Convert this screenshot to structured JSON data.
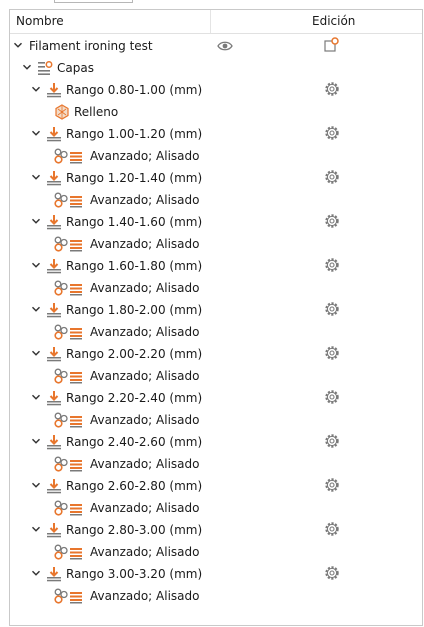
{
  "header": {
    "col_name": "Nombre",
    "col_edit": "Edición"
  },
  "tree": {
    "object": "Filament ironing test",
    "layers": "Capas",
    "ranges": [
      {
        "label": "Rango 0.80-1.00 (mm)",
        "child": "Relleno",
        "child_type": "infill"
      },
      {
        "label": "Rango 1.00-1.20 (mm)",
        "child": "Avanzado; Alisado",
        "child_type": "settings"
      },
      {
        "label": "Rango 1.20-1.40 (mm)",
        "child": "Avanzado; Alisado",
        "child_type": "settings"
      },
      {
        "label": "Rango 1.40-1.60 (mm)",
        "child": "Avanzado; Alisado",
        "child_type": "settings"
      },
      {
        "label": "Rango 1.60-1.80 (mm)",
        "child": "Avanzado; Alisado",
        "child_type": "settings"
      },
      {
        "label": "Rango 1.80-2.00 (mm)",
        "child": "Avanzado; Alisado",
        "child_type": "settings"
      },
      {
        "label": "Rango 2.00-2.20 (mm)",
        "child": "Avanzado; Alisado",
        "child_type": "settings"
      },
      {
        "label": "Rango 2.20-2.40 (mm)",
        "child": "Avanzado; Alisado",
        "child_type": "settings"
      },
      {
        "label": "Rango 2.40-2.60 (mm)",
        "child": "Avanzado; Alisado",
        "child_type": "settings"
      },
      {
        "label": "Rango 2.60-2.80 (mm)",
        "child": "Avanzado; Alisado",
        "child_type": "settings"
      },
      {
        "label": "Rango 2.80-3.00 (mm)",
        "child": "Avanzado; Alisado",
        "child_type": "settings"
      },
      {
        "label": "Rango 3.00-3.20 (mm)",
        "child": "Avanzado; Alisado",
        "child_type": "settings"
      }
    ]
  },
  "icons": {
    "expand": "chevron-down-icon",
    "visibility": "eye-icon",
    "edit": "edit-settings-icon",
    "layers": "layers-icon",
    "range": "layer-range-icon",
    "infill": "infill-icon",
    "settings": "settings-group-icon",
    "gear": "gear-icon"
  },
  "colors": {
    "accent": "#e8762d",
    "icon_gray": "#7a7a7a",
    "text": "#1a1a1a"
  }
}
